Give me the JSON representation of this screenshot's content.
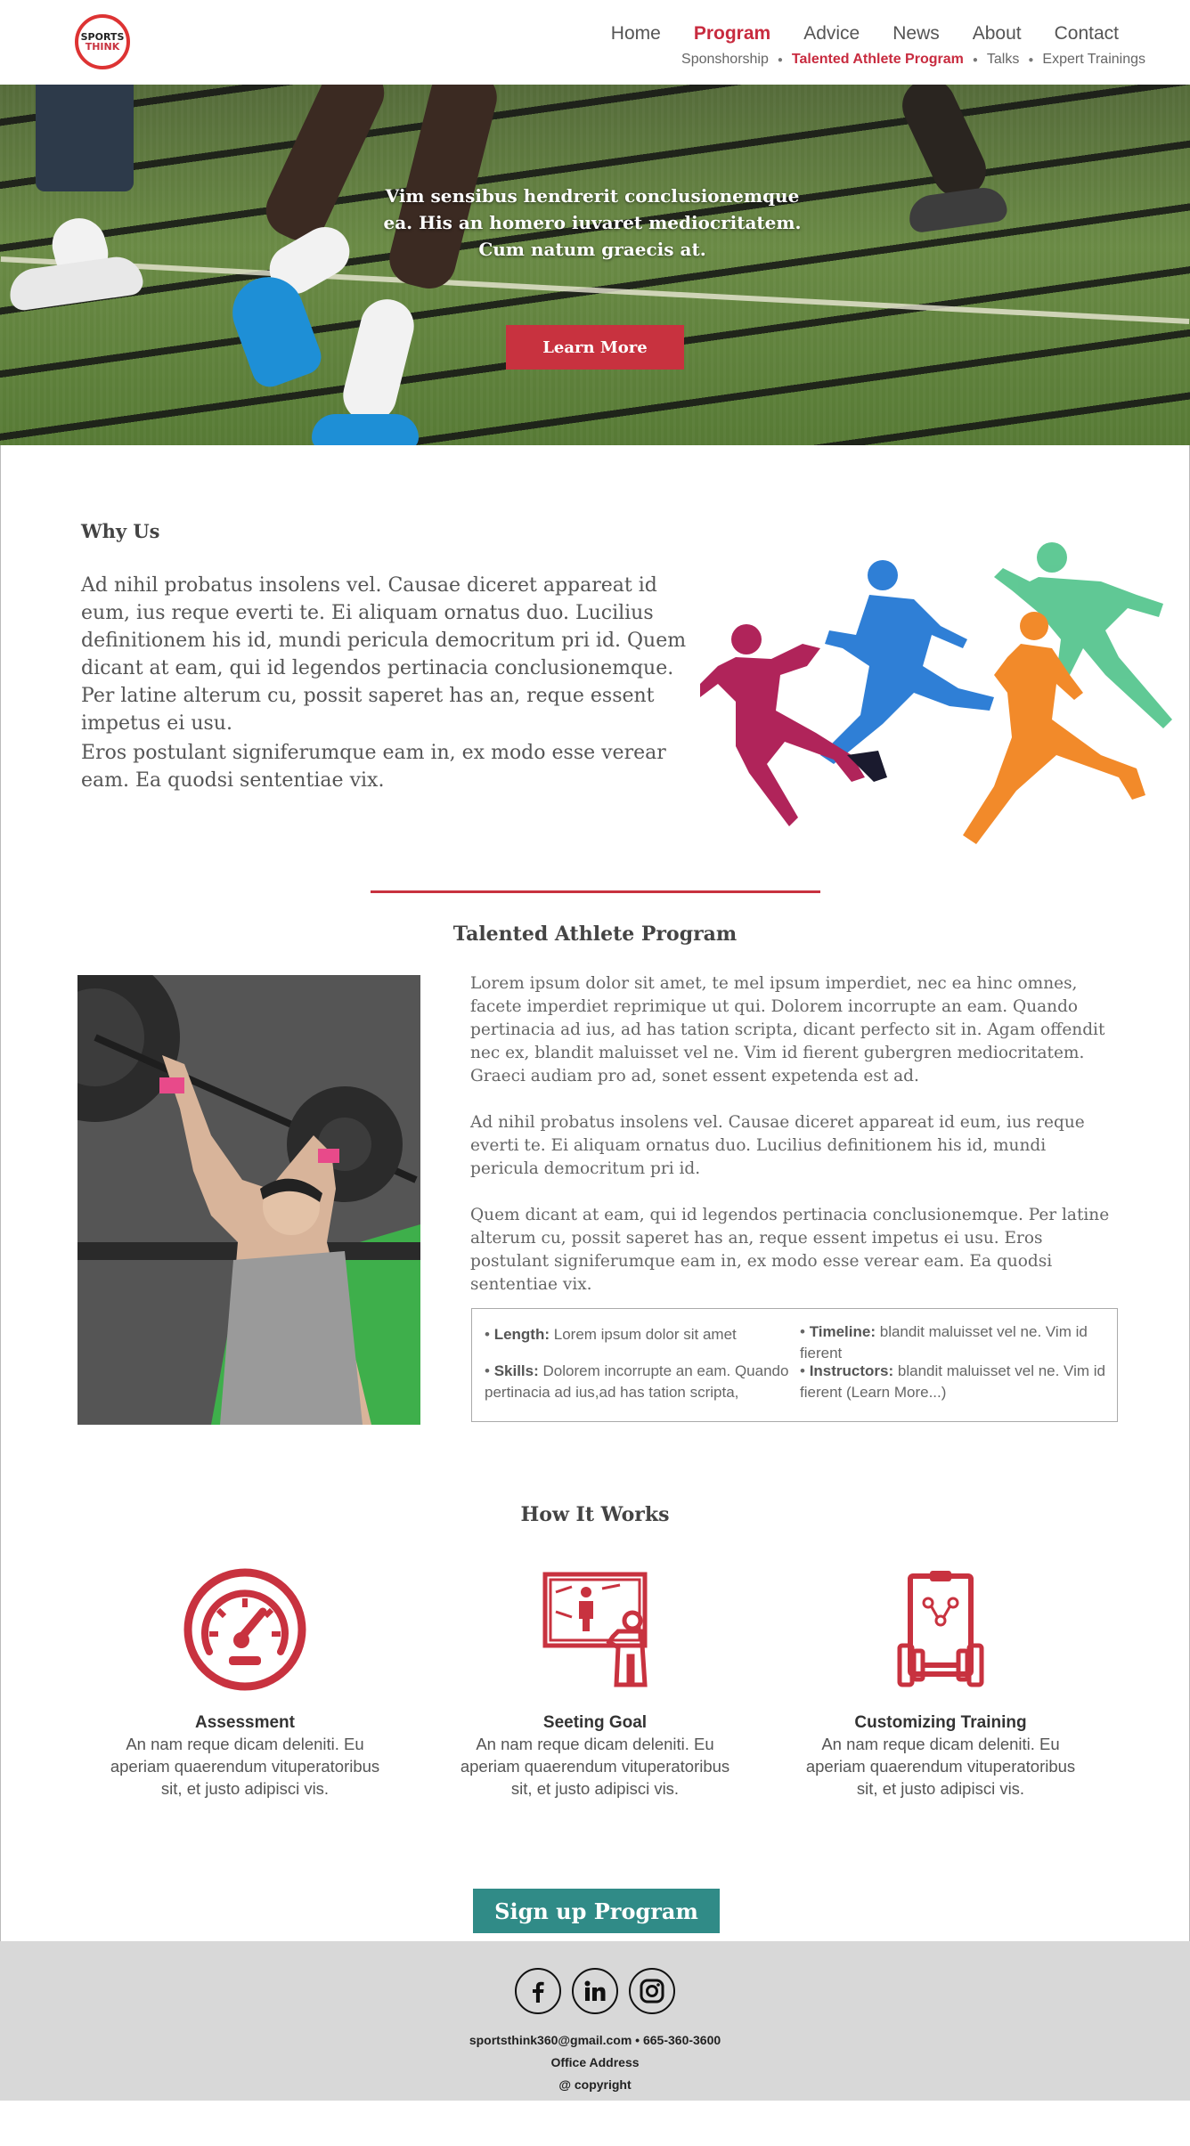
{
  "logo": {
    "line1": "SPORTS",
    "line2": "THINK"
  },
  "nav": {
    "items": [
      {
        "label": "Home"
      },
      {
        "label": "Program",
        "active": true
      },
      {
        "label": "Advice"
      },
      {
        "label": "News"
      },
      {
        "label": "About"
      },
      {
        "label": "Contact"
      }
    ],
    "sub_items": [
      {
        "label": "Sponshorship"
      },
      {
        "label": "Talented Athlete Program",
        "active": true
      },
      {
        "label": "Talks"
      },
      {
        "label": "Expert Trainings"
      }
    ]
  },
  "hero": {
    "text": "Vim sensibus hendrerit conclusionemque ea. His an homero iuvaret mediocritatem. Cum natum graecis at.",
    "button_label": "Learn More"
  },
  "why": {
    "title": "Why Us",
    "p1": "Ad nihil probatus insolens vel. Causae diceret appareat id eum, ius reque everti te. Ei aliquam ornatus duo. Lucilius definitionem his id, mundi pericula democritum pri id. Quem dicant at eam, qui id legendos pertinacia conclusionemque. Per latine alterum cu, possit saperet has an, reque essent impetus ei usu.",
    "p2": "Eros postulant signiferumque eam in, ex modo esse verear eam. Ea quodsi sententiae vix."
  },
  "talented": {
    "title": "Talented Athlete Program",
    "paragraphs": [
      "Lorem ipsum dolor sit amet, te mel ipsum imperdiet, nec ea hinc omnes, facete imperdiet reprimique ut qui. Dolorem incorrupte an eam. Quando pertinacia ad ius, ad has tation scripta, dicant perfecto sit in. Agam offendit nec ex, blandit maluisset vel ne. Vim id fierent gubergren mediocritatem. Graeci audiam pro ad, sonet essent expetenda est ad.",
      "Ad nihil probatus insolens vel. Causae diceret appareat id eum, ius reque everti te. Ei aliquam ornatus duo. Lucilius definitionem his id, mundi pericula democritum pri id.",
      "Quem dicant at eam, qui id legendos pertinacia conclusionemque. Per latine alterum cu, possit saperet has an, reque essent impetus ei usu. Eros postulant signiferumque eam in, ex modo esse verear eam. Ea quodsi sententiae vix."
    ],
    "info": {
      "length_label": "Length:",
      "length_value": "Lorem ipsum dolor sit amet",
      "skills_label": "Skills:",
      "skills_value": "Dolorem incorrupte an eam. Quando pertinacia ad ius,ad has tation scripta,",
      "timeline_label": "Timeline:",
      "timeline_value": "blandit maluisset vel ne. Vim id fierent",
      "instructors_label": "Instructors:",
      "instructors_value": "blandit maluisset vel ne. Vim id fierent (Learn More...)"
    }
  },
  "how": {
    "title": "How It Works",
    "steps": [
      {
        "icon": "speedometer-icon",
        "title": "Assessment",
        "text": "An nam reque dicam deleniti. Eu aperiam quaerendum vituperatoribus sit, et justo adipisci vis."
      },
      {
        "icon": "presentation-board-icon",
        "title": "Seeting Goal",
        "text": "An nam reque dicam deleniti. Eu aperiam quaerendum vituperatoribus sit, et justo adipisci vis."
      },
      {
        "icon": "clipboard-dumbbell-icon",
        "title": "Customizing Training",
        "text": "An nam reque dicam deleniti. Eu aperiam quaerendum vituperatoribus sit, et justo adipisci vis."
      }
    ],
    "button_label": "Sign up Program"
  },
  "footer": {
    "social": [
      "facebook-icon",
      "linkedin-icon",
      "instagram-icon"
    ],
    "contact": "sportsthink360@gmail.com  •  665-360-3600",
    "address": "Office Address",
    "copyright": "@ copyright"
  },
  "colors": {
    "accent": "#c8323f",
    "teal": "#308b87",
    "footer_bg": "#d8d8d8"
  }
}
